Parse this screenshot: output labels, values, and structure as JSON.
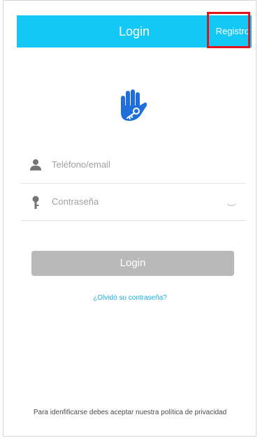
{
  "header": {
    "title": "Login",
    "register_label": "Registro"
  },
  "form": {
    "phone_email_placeholder": "Teléfono/email",
    "password_placeholder": "Contraseña",
    "login_button_label": "Login",
    "forgot_password_link": "¿Olvidó su contraseña?"
  },
  "footer": {
    "policy_text": "Para idenfificarse debes aceptar nuestra política de privacidad"
  },
  "icons": {
    "logo": "hand-key-icon",
    "phone_email": "user-icon",
    "password": "key-icon",
    "toggle": "eye-closed-icon"
  },
  "colors": {
    "header_bg": "#14c8f5",
    "logo_blue": "#1e6fd9",
    "button_disabled": "#b9b9b9",
    "link": "#19b0d9",
    "highlight_box": "#e3121b"
  }
}
